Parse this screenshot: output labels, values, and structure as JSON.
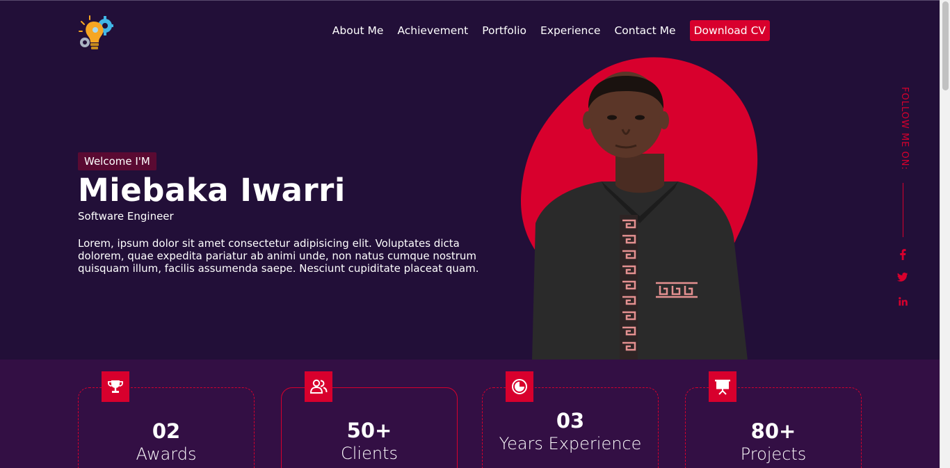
{
  "nav": {
    "items": [
      "About Me",
      "Achievement",
      "Portfolio",
      "Experience",
      "Contact Me"
    ],
    "cta": "Download CV"
  },
  "hero": {
    "welcome": "Welcome I'M",
    "name": "Miebaka Iwarri",
    "role": "Software Engineer",
    "bio": "Lorem, ipsum dolor sit amet consectetur adipisicing elit. Voluptates dicta dolorem, quae expedita pariatur ab animi unde, non natus cumque nostrum quisquam illum, facilis assumenda saepe. Nesciunt cupiditate placeat quam."
  },
  "social": {
    "label": "FOLLOW ME ON:",
    "icons": [
      "facebook-icon",
      "twitter-icon",
      "linkedin-icon"
    ]
  },
  "stats": [
    {
      "num": "02",
      "label": "Awards",
      "icon": "trophy-icon"
    },
    {
      "num": "50+",
      "label": "Clients",
      "icon": "users-icon"
    },
    {
      "num": "03",
      "label": "Years Experience",
      "icon": "clock-icon"
    },
    {
      "num": "80+",
      "label": "Projects",
      "icon": "presentation-icon"
    }
  ],
  "colors": {
    "background": "#220f38",
    "stats_background": "#330f44",
    "accent": "#d8002d",
    "welcome_badge": "#5a0a32"
  }
}
